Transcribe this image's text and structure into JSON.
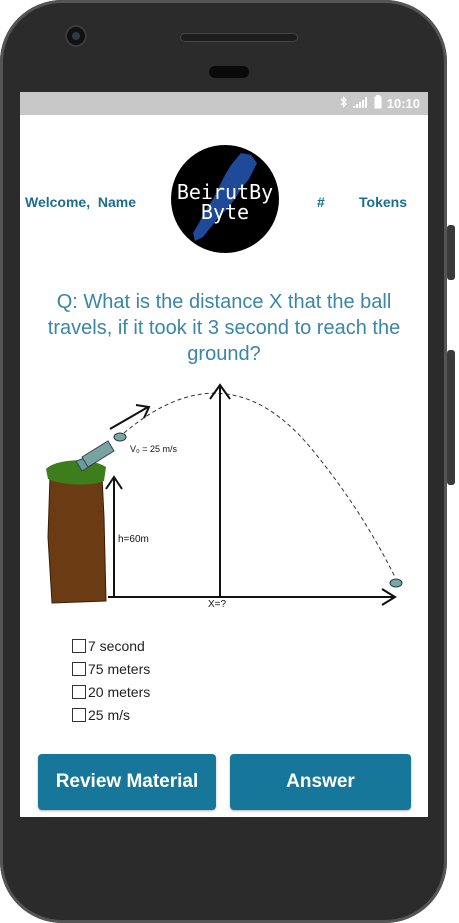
{
  "status_bar": {
    "time": "10:10",
    "icons": [
      "bluetooth-icon",
      "signal-icon",
      "battery-icon"
    ]
  },
  "header": {
    "welcome": "Welcome,",
    "name": "Name",
    "hash": "#",
    "tokens": "Tokens",
    "logo_line1": "BeirutBy",
    "logo_line2": "Byte"
  },
  "question": "Q: What is the distance X that the ball travels, if it took it 3 second to reach the ground?",
  "figure": {
    "velocity_label": "V₀ = 25 m/s",
    "height_label": "h=60m",
    "distance_label": "X=?"
  },
  "options": [
    {
      "label": "7 second",
      "checked": false
    },
    {
      "label": "75 meters",
      "checked": false
    },
    {
      "label": "20 meters",
      "checked": false
    },
    {
      "label": "25 m/s",
      "checked": false
    }
  ],
  "buttons": {
    "review": "Review Material",
    "answer": "Answer"
  },
  "colors": {
    "accent": "#17779b",
    "header_text": "#1a6e8f",
    "question_text": "#3a86a8",
    "status_bar": "#c8c8c8"
  }
}
